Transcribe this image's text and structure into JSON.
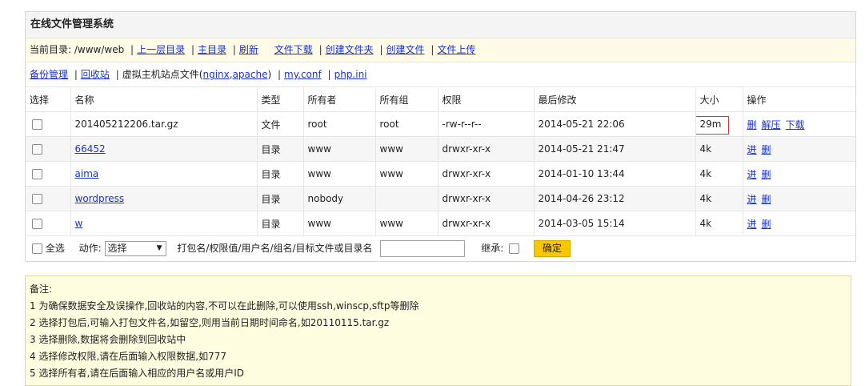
{
  "title": "在线文件管理系统",
  "path": {
    "label": "当前目录:",
    "value": "/www/web"
  },
  "nav1": [
    "上一层目录",
    "主目录",
    "刷新",
    "文件下载",
    "创建文件夹",
    "创建文件",
    "文件上传"
  ],
  "nav2": {
    "backup": "备份管理",
    "recycle": "回收站",
    "vhost_prefix": "虚拟主机站点文件(",
    "nginx": "nginx",
    "comma": ",",
    "apache": "apache",
    "vhost_suffix": ")",
    "myconf": "my.conf",
    "phpini": "php.ini"
  },
  "table": {
    "headers": [
      "选择",
      "名称",
      "类型",
      "所有者",
      "所有组",
      "权限",
      "最后修改",
      "大小",
      "操作"
    ],
    "rows": [
      {
        "name": "201405212206.tar.gz",
        "type": "文件",
        "owner": "root",
        "group": "root",
        "perm": "-rw-r--r--",
        "mtime": "2014-05-21 22:06",
        "size": "29m",
        "ops": [
          "删",
          "解压",
          "下载"
        ]
      },
      {
        "name": "66452",
        "type": "目录",
        "owner": "www",
        "group": "www",
        "perm": "drwxr-xr-x",
        "mtime": "2014-05-21 21:47",
        "size": "4k",
        "ops": [
          "进",
          "删"
        ]
      },
      {
        "name": "aima",
        "type": "目录",
        "owner": "www",
        "group": "www",
        "perm": "drwxr-xr-x",
        "mtime": "2014-01-10 13:44",
        "size": "4k",
        "ops": [
          "进",
          "删"
        ]
      },
      {
        "name": "wordpress",
        "type": "目录",
        "owner": "nobody",
        "group": "",
        "perm": "drwxr-xr-x",
        "mtime": "2014-04-26 23:12",
        "size": "4k",
        "ops": [
          "进",
          "删"
        ]
      },
      {
        "name": "w",
        "type": "目录",
        "owner": "www",
        "group": "www",
        "perm": "drwxr-xr-x",
        "mtime": "2014-03-05 15:14",
        "size": "4k",
        "ops": [
          "进",
          "删"
        ]
      }
    ]
  },
  "actions": {
    "select_all": "全选",
    "action_label": "动作:",
    "select_value": "选择",
    "input_label": "打包名/权限值/用户名/组名/目标文件或目录名",
    "inherit_label": "继承:",
    "confirm": "确定"
  },
  "notes": {
    "title": "备注:",
    "lines": [
      "1 为确保数据安全及误操作,回收站的内容,不可以在此删除,可以使用ssh,winscp,sftp等删除",
      "2 选择打包后,可输入打包文件名,如留空,则用当前日期时间命名,如20110115.tar.gz",
      "3 选择删除,数据将会删除到回收站中",
      "4 选择修改权限,请在后面输入权限数据,如777",
      "5 选择所有者,请在后面输入相应的用户名或用户ID"
    ]
  }
}
